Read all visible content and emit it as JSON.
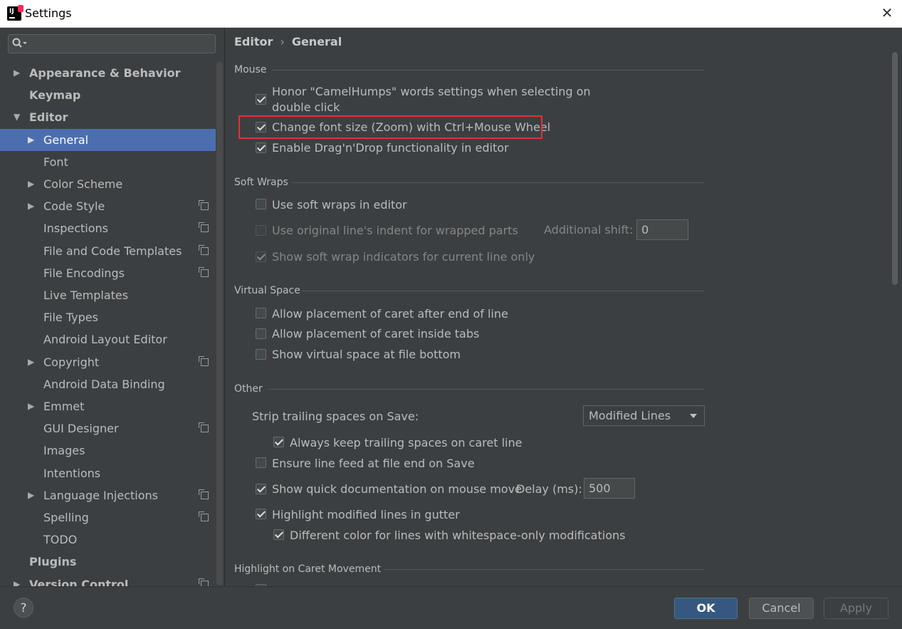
{
  "window": {
    "title": "Settings"
  },
  "sidebar": {
    "items": [
      {
        "label": "Appearance & Behavior",
        "arrow": "▶",
        "bold": true
      },
      {
        "label": "Keymap",
        "bold": true
      },
      {
        "label": "Editor",
        "arrow": "▼",
        "bold": true
      },
      {
        "label": "General",
        "arrow": "▶",
        "selected": true
      },
      {
        "label": "Font"
      },
      {
        "label": "Color Scheme",
        "arrow": "▶"
      },
      {
        "label": "Code Style",
        "arrow": "▶",
        "copy": true
      },
      {
        "label": "Inspections",
        "copy": true
      },
      {
        "label": "File and Code Templates",
        "copy": true
      },
      {
        "label": "File Encodings",
        "copy": true
      },
      {
        "label": "Live Templates"
      },
      {
        "label": "File Types"
      },
      {
        "label": "Android Layout Editor"
      },
      {
        "label": "Copyright",
        "arrow": "▶",
        "copy": true
      },
      {
        "label": "Android Data Binding"
      },
      {
        "label": "Emmet",
        "arrow": "▶"
      },
      {
        "label": "GUI Designer",
        "copy": true
      },
      {
        "label": "Images"
      },
      {
        "label": "Intentions"
      },
      {
        "label": "Language Injections",
        "arrow": "▶",
        "copy": true
      },
      {
        "label": "Spelling",
        "copy": true
      },
      {
        "label": "TODO"
      },
      {
        "label": "Plugins",
        "bold": true
      },
      {
        "label": "Version Control",
        "arrow": "▶",
        "bold": true,
        "copy": true
      }
    ]
  },
  "breadcrumb": {
    "parent": "Editor",
    "separator": "›",
    "current": "General"
  },
  "sections": {
    "mouse": "Mouse",
    "soft_wraps": "Soft Wraps",
    "virtual_space": "Virtual Space",
    "other": "Other",
    "highlight_caret": "Highlight on Caret Movement"
  },
  "mouse": {
    "camelhumps_line1": "Honor \"CamelHumps\" words settings when selecting on",
    "camelhumps_line2": "double click",
    "zoom": "Change font size (Zoom) with Ctrl+Mouse Wheel",
    "dragdrop": "Enable Drag'n'Drop functionality in editor"
  },
  "soft_wraps": {
    "use": "Use soft wraps in editor",
    "indent": "Use original line's indent for wrapped parts",
    "additional_shift_label": "Additional shift:",
    "additional_shift_value": "0",
    "indicators": "Show soft wrap indicators for current line only"
  },
  "virtual_space": {
    "after_end": "Allow placement of caret after end of line",
    "inside_tabs": "Allow placement of caret inside tabs",
    "file_bottom": "Show virtual space at file bottom"
  },
  "other": {
    "strip_label": "Strip trailing spaces on Save:",
    "strip_value": "Modified Lines",
    "keep_trailing": "Always keep trailing spaces on caret line",
    "line_feed": "Ensure line feed at file end on Save",
    "quick_doc": "Show quick documentation on mouse move",
    "delay_label": "Delay (ms):",
    "delay_value": "500",
    "highlight_modified": "Highlight modified lines in gutter",
    "whitespace_color": "Different color for lines with whitespace-only modifications"
  },
  "buttons": {
    "help": "?",
    "ok": "OK",
    "cancel": "Cancel",
    "apply": "Apply"
  }
}
